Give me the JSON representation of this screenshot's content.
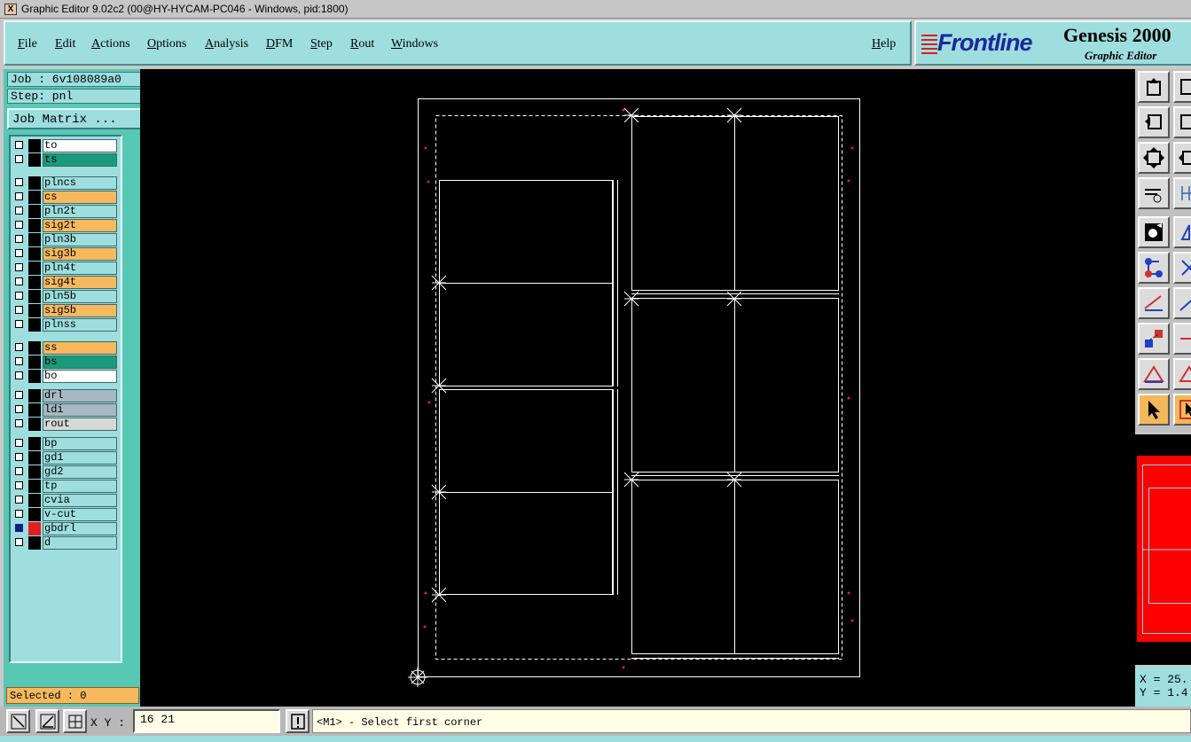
{
  "window": {
    "title": "Graphic Editor 9.02c2 (00@HY-HYCAM-PC046 - Windows, pid:1800)",
    "icon_glyph": "X"
  },
  "menu": {
    "items": [
      "File",
      "Edit",
      "Actions",
      "Options",
      "Analysis",
      "DFM",
      "Step",
      "Rout",
      "Windows"
    ],
    "help": "Help"
  },
  "logo": {
    "brand": "Frontline",
    "product": "Genesis 2000 ",
    "subtitle": "Graphic Editor"
  },
  "job": {
    "job_line": "Job : 6v108089a0",
    "step_line": "Step: pnl",
    "matrix_button": "Job Matrix ..."
  },
  "layers": [
    {
      "name": "to",
      "color": "#ffffff"
    },
    {
      "name": "ts",
      "color": "#1a9a7a"
    },
    {
      "name": "plncs",
      "color": "#9edede"
    },
    {
      "name": "cs",
      "color": "#f7b85e"
    },
    {
      "name": "pln2t",
      "color": "#9edede"
    },
    {
      "name": "sig2t",
      "color": "#f7b85e"
    },
    {
      "name": "pln3b",
      "color": "#9edede"
    },
    {
      "name": "sig3b",
      "color": "#f7b85e"
    },
    {
      "name": "pln4t",
      "color": "#9edede"
    },
    {
      "name": "sig4t",
      "color": "#f7b85e"
    },
    {
      "name": "pln5b",
      "color": "#9edede"
    },
    {
      "name": "sig5b",
      "color": "#f7b85e"
    },
    {
      "name": "plnss",
      "color": "#9edede"
    },
    {
      "name": "ss",
      "color": "#f7b85e"
    },
    {
      "name": "bs",
      "color": "#1a9a7a"
    },
    {
      "name": "bo",
      "color": "#ffffff"
    },
    {
      "name": "drl",
      "color": "#a8b8c0"
    },
    {
      "name": "ldi",
      "color": "#a8b8c0"
    },
    {
      "name": "rout",
      "color": "#d8d8d8"
    },
    {
      "name": "bp",
      "color": "#9edede"
    },
    {
      "name": "gd1",
      "color": "#9edede"
    },
    {
      "name": "gd2",
      "color": "#9edede"
    },
    {
      "name": "tp",
      "color": "#9edede"
    },
    {
      "name": "cvia",
      "color": "#9edede"
    },
    {
      "name": "v-cut",
      "color": "#9edede"
    },
    {
      "name": "gbdrl",
      "color": "#9edede",
      "active": true
    },
    {
      "name": "d",
      "color": "#9edede"
    }
  ],
  "selection": {
    "text": "Selected : 0"
  },
  "coordinates": {
    "x": "X = 25.",
    "y": "Y = 1.4"
  },
  "status": {
    "xy_label": "X Y :",
    "xy_value": "16 21",
    "prompt": "<M1> - Select first corner"
  },
  "colors": {
    "panel_teal": "#56c8b4",
    "menu_cyan": "#9edede",
    "canvas_bg": "#000000",
    "highlight_orange": "#f7b85e",
    "thumbnail_red": "#ff0000"
  }
}
